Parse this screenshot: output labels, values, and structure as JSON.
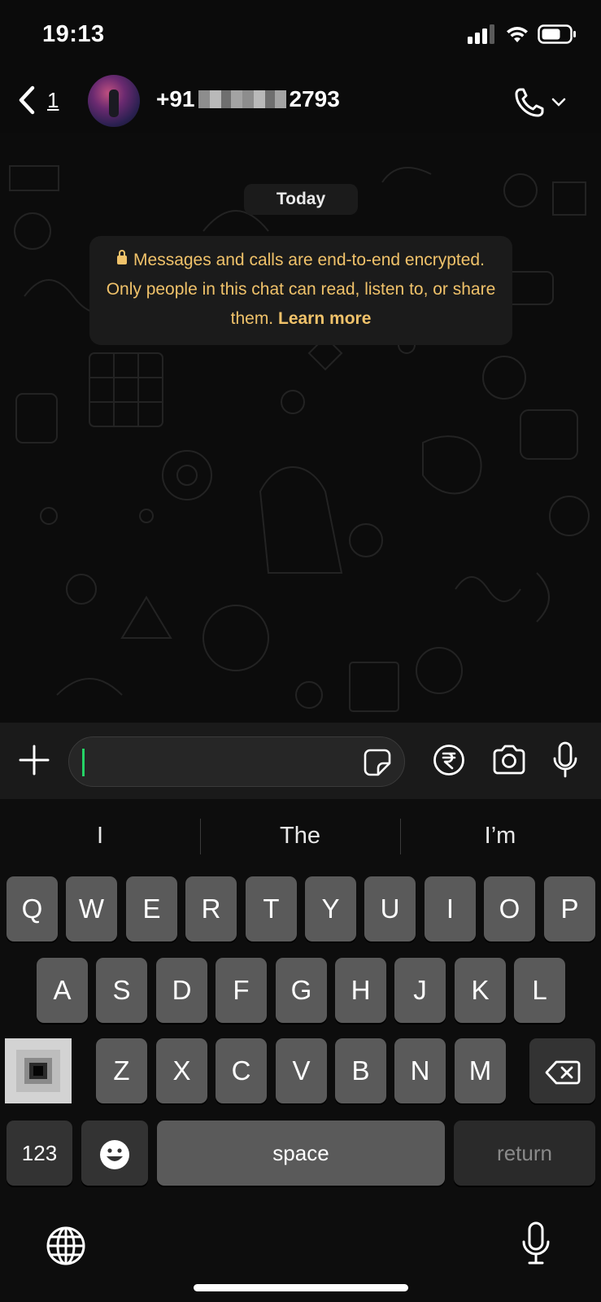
{
  "status_bar": {
    "time": "19:13",
    "icons": [
      "signal-icon",
      "wifi-icon",
      "battery-icon"
    ]
  },
  "header": {
    "back_count": "1",
    "contact_prefix": "+91",
    "contact_suffix": "2793",
    "icons": [
      "chevron-left-icon",
      "phone-icon",
      "chevron-down-icon"
    ]
  },
  "chat": {
    "date_chip": "Today",
    "encryption_notice": "Messages and calls are end-to-end encrypted. Only people in this chat can read, listen to, or share them.",
    "learn_more": "Learn more"
  },
  "composer": {
    "input_value": "",
    "icons": [
      "plus-icon",
      "sticker-icon",
      "rupee-icon",
      "camera-icon",
      "microphone-icon"
    ]
  },
  "keyboard": {
    "suggestions": [
      "I",
      "The",
      "I’m"
    ],
    "row1": [
      "Q",
      "W",
      "E",
      "R",
      "T",
      "Y",
      "U",
      "I",
      "O",
      "P"
    ],
    "row2": [
      "A",
      "S",
      "D",
      "F",
      "G",
      "H",
      "J",
      "K",
      "L"
    ],
    "row3": [
      "Z",
      "X",
      "C",
      "V",
      "B",
      "N",
      "M"
    ],
    "numbers_label": "123",
    "space_label": "space",
    "return_label": "return",
    "icons": [
      "shift-icon",
      "backspace-icon",
      "emoji-icon",
      "globe-icon",
      "dictation-icon"
    ]
  },
  "colors": {
    "accent": "#25d366",
    "notice_text": "#f0c26a",
    "key": "#5a5a5a",
    "background": "#0b0b0b"
  }
}
